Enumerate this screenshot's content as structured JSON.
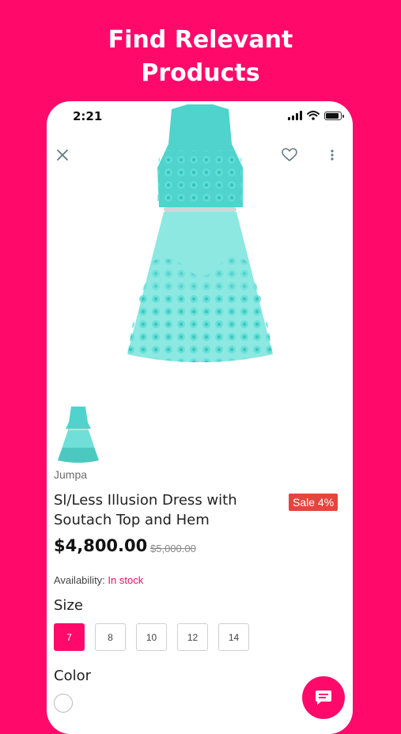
{
  "promo": {
    "line1": "Find Relevant",
    "line2": "Products"
  },
  "status_bar": {
    "time": "2:21"
  },
  "product": {
    "brand": "Jumpa",
    "title": "Sl/Less Illusion Dress with Soutach Top and Hem",
    "sale_badge": "Sale 4%",
    "price": "$4,800.00",
    "old_price": "$5,000.00",
    "availability": {
      "label": "Availability:",
      "value": "In stock"
    },
    "size": {
      "label": "Size",
      "options": [
        "7",
        "8",
        "10",
        "12",
        "14"
      ],
      "selected": "7"
    },
    "color": {
      "label": "Color"
    }
  },
  "colors": {
    "accent": "#ff0a6b",
    "sale": "#e3463f",
    "dress": "#4fd3cc"
  },
  "icons": [
    "close-icon",
    "heart-icon",
    "more-vertical-icon",
    "chat-icon",
    "wifi-icon",
    "signal-icon",
    "battery-icon"
  ]
}
